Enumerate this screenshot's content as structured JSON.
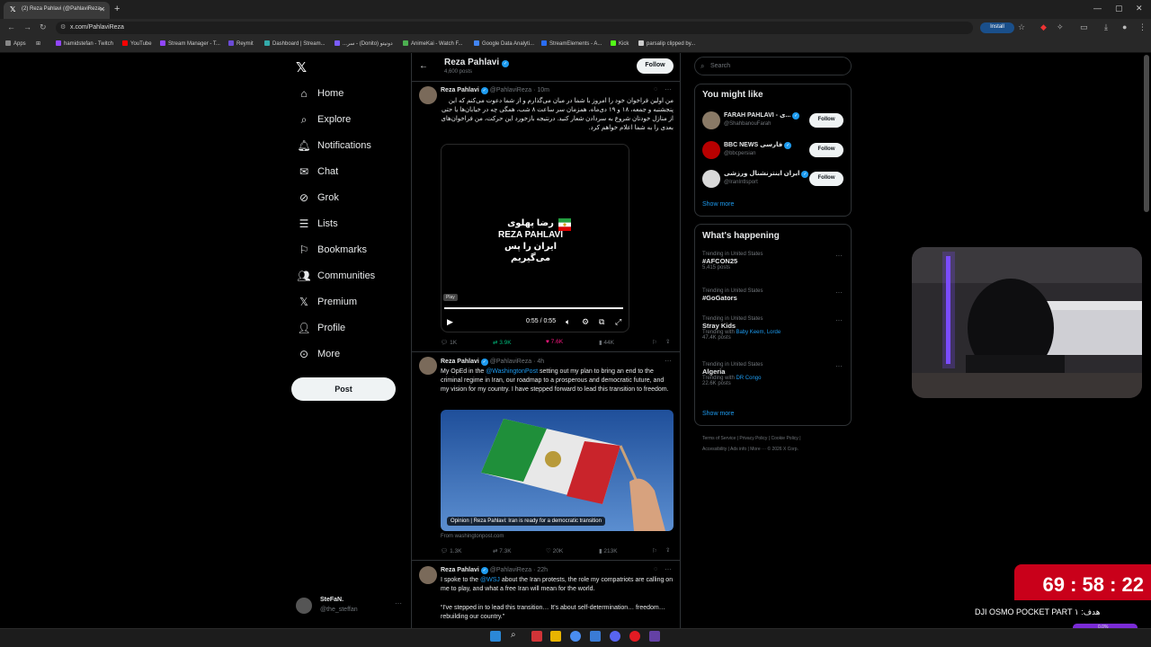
{
  "browser": {
    "tab_title": "(2) Reza Pahlavi (@PahlaviReza...",
    "url": "x.com/PahlaviReza",
    "install_label": "Install",
    "bookmarks": [
      "Apps",
      "hamidstefan - Twitch",
      "YouTube",
      "Stream Manager - T...",
      "Reymit",
      "Dashboard | Stream...",
      "...سر - (Donito) دونیتو",
      "AnimeKai - Watch F...",
      "Google Data Analyti...",
      "StreamElements - A...",
      "Kick",
      "parsalip clipped by..."
    ]
  },
  "nav": {
    "items": [
      {
        "label": "Home",
        "icon": "home-icon"
      },
      {
        "label": "Explore",
        "icon": "search-icon"
      },
      {
        "label": "Notifications",
        "icon": "bell-icon"
      },
      {
        "label": "Chat",
        "icon": "mail-icon"
      },
      {
        "label": "Grok",
        "icon": "grok-icon"
      },
      {
        "label": "Lists",
        "icon": "list-icon"
      },
      {
        "label": "Bookmarks",
        "icon": "bookmark-icon"
      },
      {
        "label": "Communities",
        "icon": "people-icon"
      },
      {
        "label": "Premium",
        "icon": "x-icon"
      },
      {
        "label": "Profile",
        "icon": "person-icon"
      },
      {
        "label": "More",
        "icon": "more-icon"
      }
    ],
    "post_label": "Post",
    "account_name": "SteFaN.",
    "account_handle": "@the_steffan"
  },
  "profile_header": {
    "name": "Reza Pahlavi",
    "posts": "4,600 posts",
    "follow_label": "Follow"
  },
  "tweets": [
    {
      "name": "Reza Pahlavi",
      "handle": "@PahlaviReza",
      "time": "· 10m",
      "text": "من اولین فراخوان خود را امروز با شما در میان می‌گذارم و از شما دعوت می‌کنم که این پنجشنبه و جمعه، ۱۸ و ۱۹ دی‌ماه، همزمان سر ساعت ۸ شب، همگی چه در خیابان‌ها یا حتی از منازل خودتان شروع به سردادن شعار کنید. درنتیجه بازخورد این حرکت، من فراخوان‌های بعدی را به شما اعلام خواهم کرد.",
      "video": {
        "title_fa": "رضا پهلوی",
        "title_en": "REZA PAHLAVI",
        "subtitle_fa": "ایران را پس می‌گیریم",
        "time": "0:55 / 0:55",
        "play_tooltip": "Play",
        "progress": 1.0
      },
      "replies": "1K",
      "reposts": "3.9K",
      "likes": "7.6K",
      "views": "44K"
    },
    {
      "name": "Reza Pahlavi",
      "handle": "@PahlaviReza",
      "time": "· 4h",
      "text_pre": "My OpEd in the ",
      "link": "@WashingtonPost",
      "text_post": " setting out my plan to bring an end to the criminal regime in Iran, our roadmap to a prosperous and democratic future, and my vision for my country. I have stepped forward to lead this transition to freedom.",
      "image_caption": "Opinion | Reza Pahlavi: Iran is ready for a democratic transition",
      "source": "From washingtonpost.com",
      "replies": "1.3K",
      "reposts": "7.3K",
      "likes": "20K",
      "views": "213K"
    },
    {
      "name": "Reza Pahlavi",
      "handle": "@PahlaviReza",
      "time": "· 22h",
      "text_pre": "I spoke to the ",
      "link": "@WSJ",
      "text_post": " about the Iran protests, the role my compatriots are calling on me to play, and what a free Iran will mean for the world.",
      "quote": "“I've stepped in to lead this transition… It's about self-determination… freedom… rebuilding our country.”"
    }
  ],
  "right": {
    "search_placeholder": "Search",
    "you_might_like": "You might like",
    "suggestions": [
      {
        "name": "FARAH PAHLAVI - ی...",
        "handle": "@ShahbanouFarah",
        "follow": "Follow",
        "color": "#8a7a66"
      },
      {
        "name": "BBC NEWS فارسی",
        "handle": "@bbcpersian",
        "follow": "Follow",
        "color": "#b80000"
      },
      {
        "name": "ایران اینترنشنال ورزشی",
        "handle": "@IranIntlsport",
        "follow": "Follow",
        "color": "#d9d9d9"
      }
    ],
    "show_more": "Show more",
    "whats_happening": "What's happening",
    "trends": [
      {
        "context": "Trending in United States",
        "name": "#AFCON25",
        "meta": "5,415 posts"
      },
      {
        "context": "Trending in United States",
        "name": "#GoGators",
        "meta": ""
      },
      {
        "context": "Trending in United States",
        "name": "Stray Kids",
        "meta_pre": "Trending with ",
        "meta_links": "Baby Keem, Lorde",
        "meta": "47.4K posts"
      },
      {
        "context": "Trending in United States",
        "name": "Algeria",
        "meta_pre": "Trending with ",
        "meta_links": "DR Congo",
        "meta": "22.6K posts"
      }
    ],
    "show_more_2": "Show more",
    "footer": [
      "Terms of Service",
      "Privacy Policy",
      "Cookie Policy",
      "Accessibility",
      "Ads info",
      "More ···",
      "© 2026 X Corp."
    ]
  },
  "overlay": {
    "timer": "69 : 58 : 22",
    "goal_text": "DJI OSMO POCKET PART ۱ :هدف",
    "goal_value": "0.0%"
  }
}
